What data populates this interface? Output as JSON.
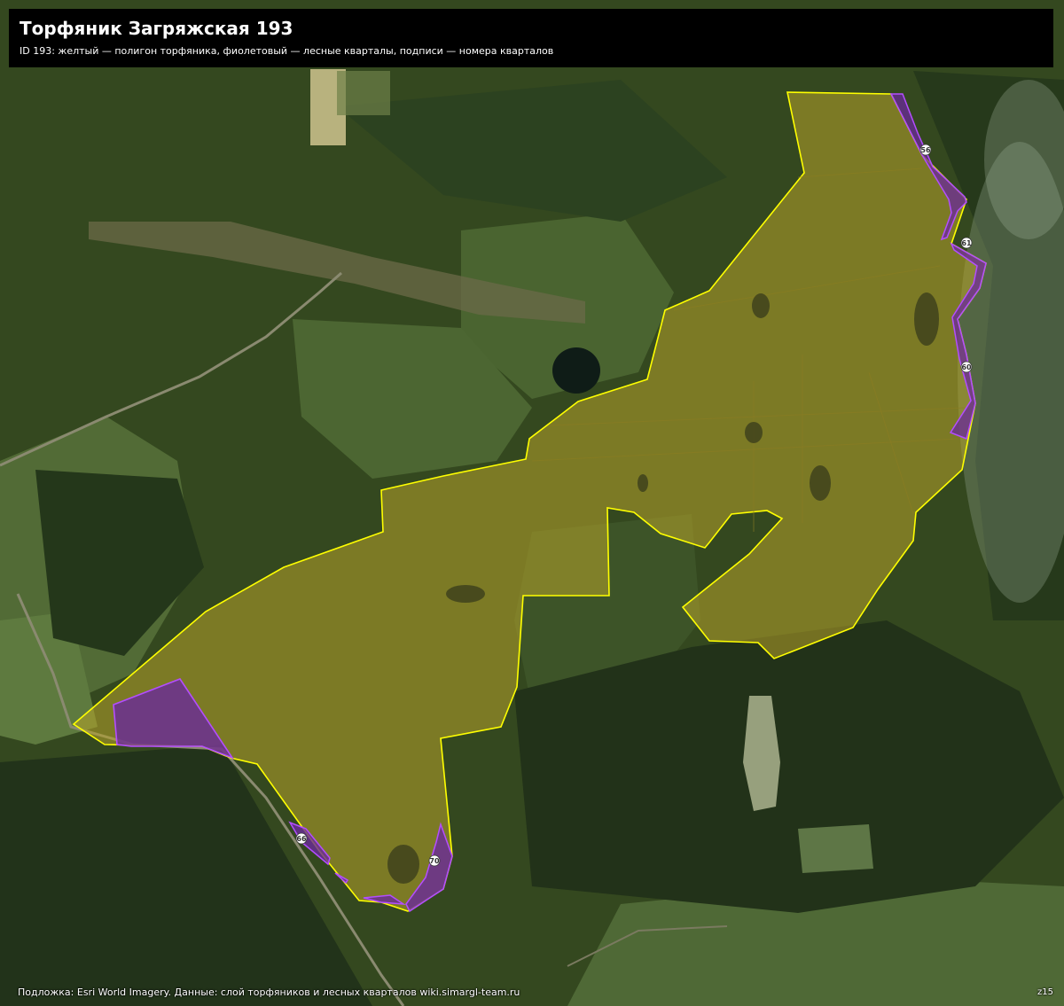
{
  "header": {
    "title": "Торфяник Загряжская 193",
    "subtitle": "ID 193: желтый — полигон торфяника, фиолетовый — лесные кварталы, подписи — номера кварталов"
  },
  "footer": {
    "credit": "Подложка: Esri World Imagery. Данные: слой торфяников и лесных кварталов wiki.simargl-team.ru",
    "zoom": "z15"
  },
  "map": {
    "peat_outline_color": "#ffff00",
    "peat_fill_color": "#b8a42a",
    "quarter_color": "#b34dff",
    "quarter_fill_color": "#6a2a9a",
    "quarter_labels": [
      "56",
      "61",
      "60",
      "66",
      "70"
    ]
  }
}
